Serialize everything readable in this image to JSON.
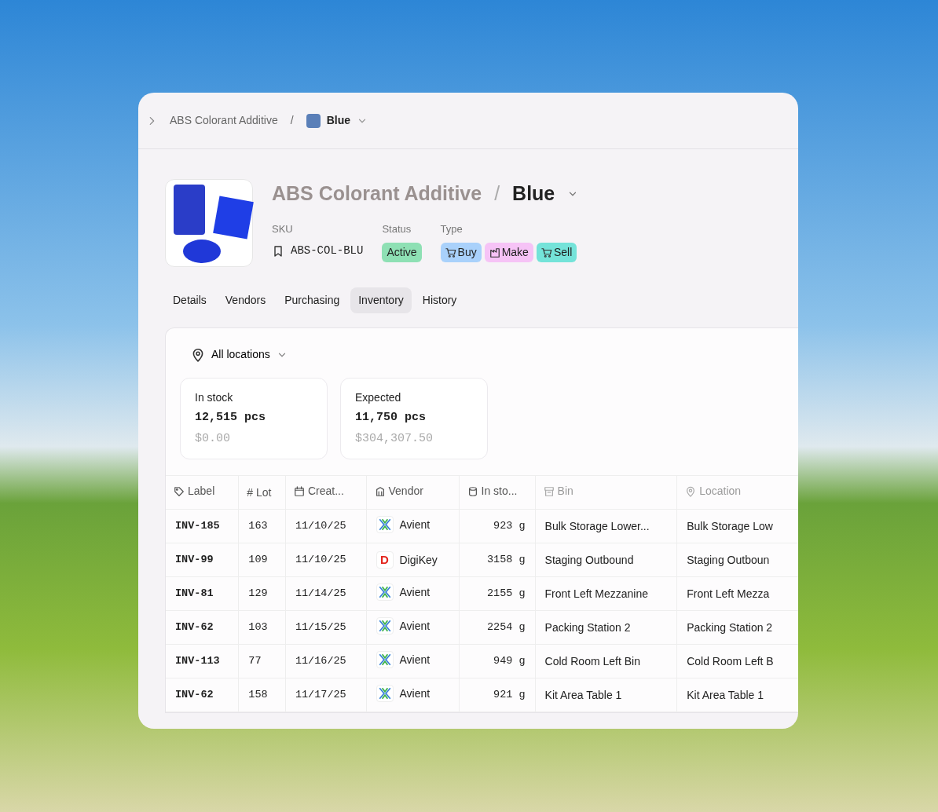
{
  "breadcrumb": {
    "parent": "ABS Colorant Additive",
    "separator": "/",
    "current": "Blue"
  },
  "header": {
    "parent": "ABS Colorant Additive",
    "separator": "/",
    "current": "Blue"
  },
  "fields": {
    "sku_label": "SKU",
    "sku": "ABS-COL-BLU",
    "status_label": "Status",
    "status": "Active",
    "type_label": "Type"
  },
  "types": [
    {
      "label": "Buy",
      "kind": "cart",
      "color": "#a9d1fb"
    },
    {
      "label": "Make",
      "kind": "factory",
      "color": "#f6c3f6"
    },
    {
      "label": "Sell",
      "kind": "cart",
      "color": "#74e3d9"
    }
  ],
  "tabs": [
    {
      "label": "Details",
      "selected": false
    },
    {
      "label": "Vendors",
      "selected": false
    },
    {
      "label": "Purchasing",
      "selected": false
    },
    {
      "label": "Inventory",
      "selected": true
    },
    {
      "label": "History",
      "selected": false
    }
  ],
  "location_filter": "All locations",
  "stats": [
    {
      "title": "In stock",
      "amount": "12,515 pcs",
      "value": "$0.00"
    },
    {
      "title": "Expected",
      "amount": "11,750 pcs",
      "value": "$304,307.50"
    }
  ],
  "table": {
    "columns": [
      {
        "label": "Label",
        "muted": false
      },
      {
        "label": "# Lot",
        "muted": false
      },
      {
        "label": "Creat...",
        "muted": false
      },
      {
        "label": "Vendor",
        "muted": false
      },
      {
        "label": "In sto...",
        "muted": false
      },
      {
        "label": "Bin",
        "muted": true
      },
      {
        "label": "Location",
        "muted": true
      }
    ],
    "rows": [
      {
        "label": "INV-185",
        "lot": "163",
        "created": "11/10/25",
        "vendor": "Avient",
        "kind": "cross",
        "stock": "923 g",
        "bin": "Bulk Storage Lower...",
        "location": "Bulk Storage Low"
      },
      {
        "label": "INV-99",
        "lot": "109",
        "created": "11/10/25",
        "vendor": "DigiKey",
        "kind": "letter",
        "logo_letter": "D",
        "stock": "3158 g",
        "bin": "Staging Outbound",
        "location": "Staging Outboun"
      },
      {
        "label": "INV-81",
        "lot": "129",
        "created": "11/14/25",
        "vendor": "Avient",
        "kind": "cross",
        "stock": "2155 g",
        "bin": "Front Left Mezzanine",
        "location": "Front Left Mezza"
      },
      {
        "label": "INV-62",
        "lot": "103",
        "created": "11/15/25",
        "vendor": "Avient",
        "kind": "cross",
        "stock": "2254 g",
        "bin": "Packing Station 2",
        "location": "Packing Station 2"
      },
      {
        "label": "INV-113",
        "lot": "77",
        "created": "11/16/25",
        "vendor": "Avient",
        "kind": "cross",
        "stock": "949 g",
        "bin": "Cold Room Left Bin",
        "location": "Cold Room Left B"
      },
      {
        "label": "INV-62",
        "lot": "158",
        "created": "11/17/25",
        "vendor": "Avient",
        "kind": "cross",
        "stock": "921 g",
        "bin": "Kit Area Table 1",
        "location": "Kit Area Table 1"
      }
    ]
  }
}
